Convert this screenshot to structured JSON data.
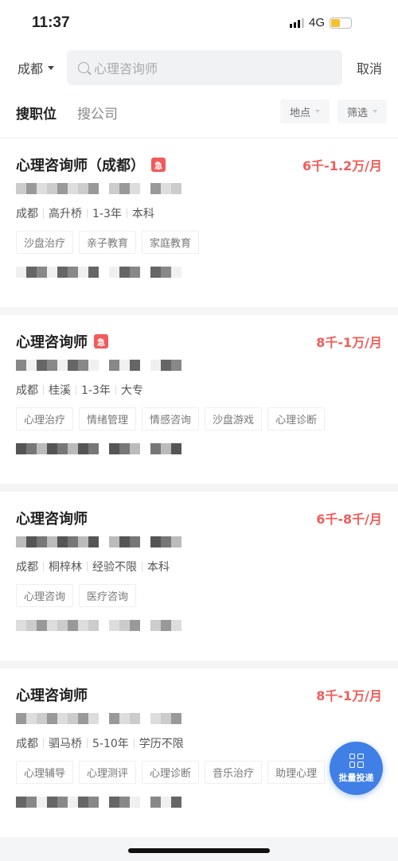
{
  "status": {
    "time": "11:37",
    "network": "4G",
    "battery_level": 0.3
  },
  "search": {
    "city": "成都",
    "query": "心理咨询师",
    "cancel": "取消"
  },
  "tabs": [
    {
      "label": "搜职位",
      "active": true
    },
    {
      "label": "搜公司",
      "active": false
    }
  ],
  "filters": [
    "地点",
    "筛选"
  ],
  "urgent_label": "急",
  "jobs": [
    {
      "title": "心理咨询师（成都）",
      "urgent": true,
      "salary": "6千-1.2万/月",
      "meta": [
        "成都",
        "高升桥",
        "1-3年",
        "本科"
      ],
      "tags": [
        "沙盘治疗",
        "亲子教育",
        "家庭教育"
      ]
    },
    {
      "title": "心理咨询师",
      "urgent": true,
      "salary": "8千-1万/月",
      "meta": [
        "成都",
        "桂溪",
        "1-3年",
        "大专"
      ],
      "tags": [
        "心理治疗",
        "情绪管理",
        "情感咨询",
        "沙盘游戏",
        "心理诊断"
      ]
    },
    {
      "title": "心理咨询师",
      "urgent": false,
      "salary": "6千-8千/月",
      "meta": [
        "成都",
        "桐梓林",
        "经验不限",
        "本科"
      ],
      "tags": [
        "心理咨询",
        "医疗咨询"
      ]
    },
    {
      "title": "心理咨询师",
      "urgent": false,
      "salary": "8千-1万/月",
      "meta": [
        "成都",
        "驷马桥",
        "5-10年",
        "学历不限"
      ],
      "tags": [
        "心理辅导",
        "心理测评",
        "心理诊断",
        "音乐治疗",
        "助理心理"
      ]
    }
  ],
  "fab": {
    "label": "批量投递",
    "color": "#3f7fe6"
  },
  "colors": {
    "salary": "#ef5d5a",
    "accent": "#3c7bea",
    "urgent": "#f25b5b"
  }
}
